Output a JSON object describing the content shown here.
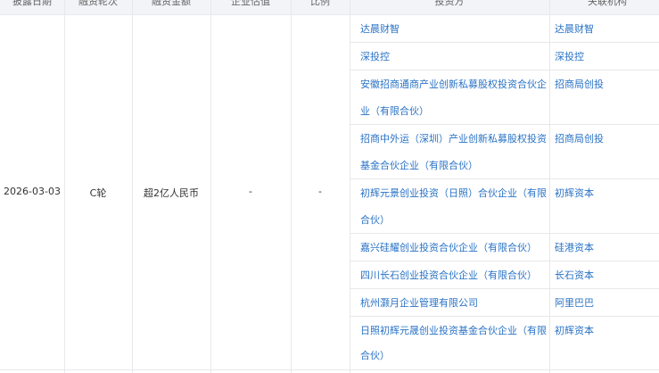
{
  "header": {
    "date": "披露日期",
    "round": "融资轮次",
    "amount": "融资金额",
    "valuation": "企业估值",
    "ratio": "比例",
    "investors": "投资方",
    "related": "关联机构"
  },
  "row": {
    "date": "2026-03-03",
    "round": "C轮",
    "amount": "超2亿人民币",
    "valuation": "-",
    "ratio": "-"
  },
  "investors": [
    {
      "name_lines": [
        "达晨财智"
      ],
      "related": "达晨财智"
    },
    {
      "name_lines": [
        "深投控"
      ],
      "related": "深投控"
    },
    {
      "name_lines": [
        "安徽招商通商产业创新私募股权投资合伙企",
        "业（有限合伙）"
      ],
      "related": "招商局创投"
    },
    {
      "name_lines": [
        "招商中外运（深圳）产业创新私募股权投资",
        "基金合伙企业（有限合伙）"
      ],
      "related": "招商局创投"
    },
    {
      "name_lines": [
        "初辉元景创业投资（日照）合伙企业（有限",
        "合伙）"
      ],
      "related": "初辉资本"
    },
    {
      "name_lines": [
        "嘉兴硅耀创业投资合伙企业（有限合伙）"
      ],
      "related": "硅港资本"
    },
    {
      "name_lines": [
        "四川长石创业投资合伙企业（有限合伙）"
      ],
      "related": "长石资本"
    },
    {
      "name_lines": [
        "杭州灏月企业管理有限公司"
      ],
      "related": "阿里巴巴"
    },
    {
      "name_lines": [
        "日照初辉元晟创业投资基金合伙企业（有限",
        "合伙）"
      ],
      "related": "初辉资本"
    }
  ]
}
